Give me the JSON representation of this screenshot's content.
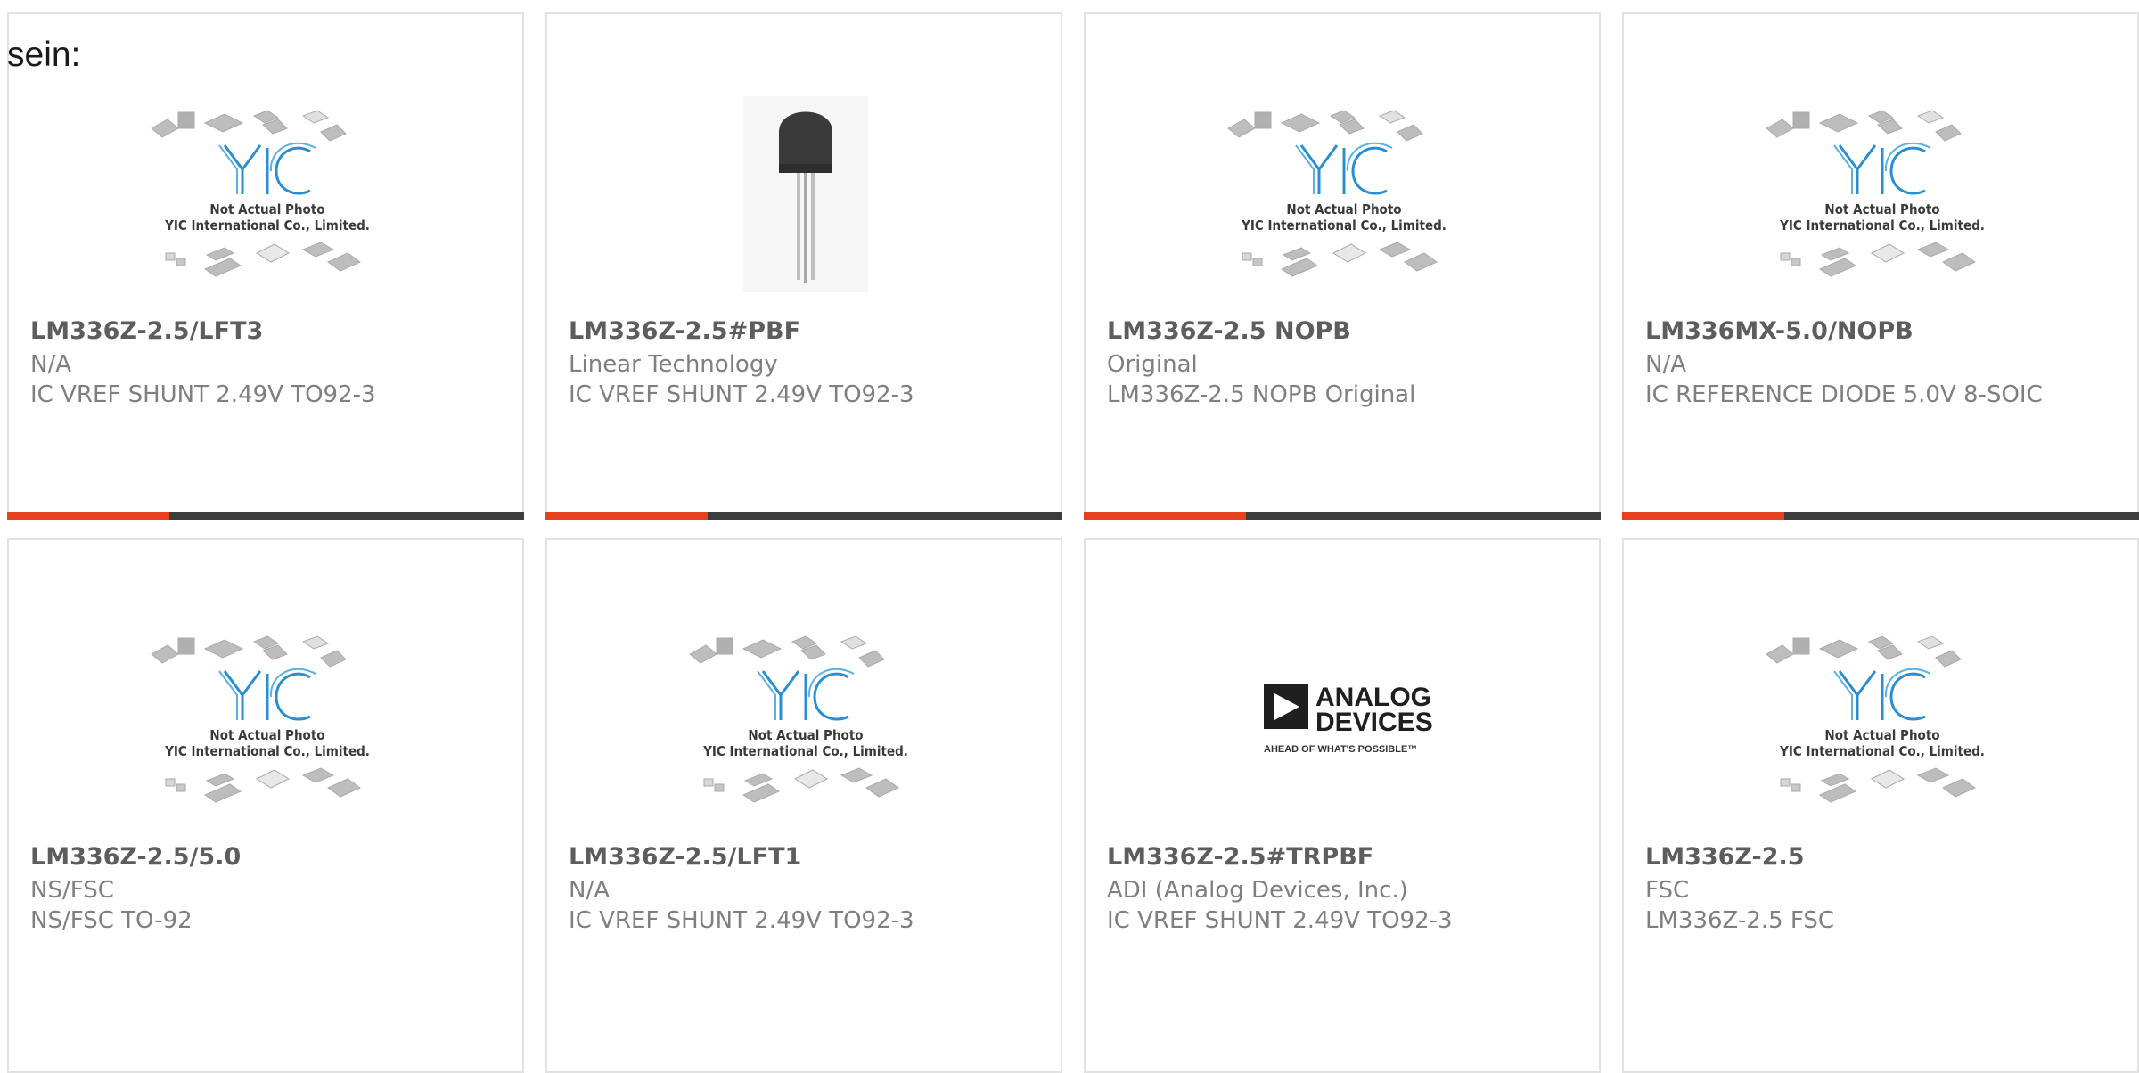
{
  "intro_text": "sein:",
  "placeholder": {
    "line1": "Not Actual Photo",
    "line2": "YIC International Co., Limited."
  },
  "adi_logo": {
    "line1": "ANALOG",
    "line2": "DEVICES",
    "tagline": "AHEAD OF WHAT'S POSSIBLE™"
  },
  "accent_color": "#e6411d",
  "bar_color": "#3d3d3d",
  "products": [
    {
      "part": "LM336Z-2.5/LFT3",
      "maker": "N/A",
      "desc": "IC VREF SHUNT 2.49V TO92-3",
      "image": "yic-placeholder"
    },
    {
      "part": "LM336Z-2.5#PBF",
      "maker": "Linear Technology",
      "desc": "IC VREF SHUNT 2.49V TO92-3",
      "image": "to92-transistor-photo"
    },
    {
      "part": "LM336Z-2.5 NOPB",
      "maker": "Original",
      "desc": "LM336Z-2.5 NOPB Original",
      "image": "yic-placeholder"
    },
    {
      "part": "LM336MX-5.0/NOPB",
      "maker": "N/A",
      "desc": "IC REFERENCE DIODE 5.0V 8-SOIC",
      "image": "yic-placeholder"
    },
    {
      "part": "LM336Z-2.5/5.0",
      "maker": "NS/FSC",
      "desc": "NS/FSC TO-92",
      "image": "yic-placeholder"
    },
    {
      "part": "LM336Z-2.5/LFT1",
      "maker": "N/A",
      "desc": "IC VREF SHUNT 2.49V TO92-3",
      "image": "yic-placeholder"
    },
    {
      "part": "LM336Z-2.5#TRPBF",
      "maker": "ADI (Analog Devices, Inc.)",
      "desc": "IC VREF SHUNT 2.49V TO92-3",
      "image": "analog-devices-logo"
    },
    {
      "part": "LM336Z-2.5",
      "maker": "FSC",
      "desc": "LM336Z-2.5 FSC",
      "image": "yic-placeholder"
    }
  ]
}
